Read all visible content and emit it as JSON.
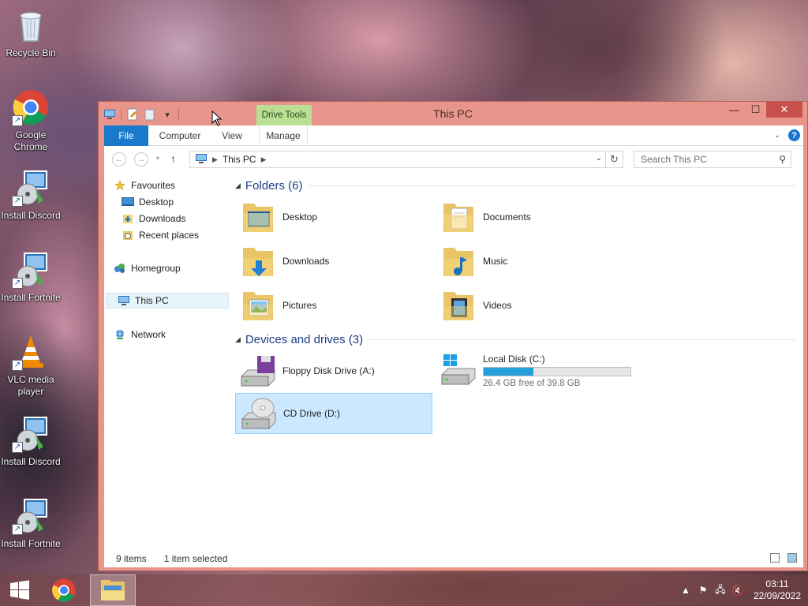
{
  "desktop": {
    "icons": [
      {
        "label": "Recycle Bin",
        "icon": "recycle-bin-icon"
      },
      {
        "label": "Google Chrome",
        "icon": "chrome-icon"
      },
      {
        "label": "Install Discord",
        "icon": "installer-icon"
      },
      {
        "label": "Install Fortnite",
        "icon": "installer-icon"
      },
      {
        "label": "VLC media player",
        "icon": "vlc-icon"
      },
      {
        "label": "Install Discord",
        "icon": "installer-icon"
      },
      {
        "label": "Install Fortnite",
        "icon": "installer-icon"
      }
    ]
  },
  "window": {
    "title": "This PC",
    "contextual_tab_group": "Drive Tools",
    "tabs": [
      "File",
      "Computer",
      "View",
      "Manage"
    ],
    "address": {
      "crumb": "This PC"
    },
    "search": {
      "placeholder": "Search This PC"
    },
    "nav_pane": {
      "favourites": "Favourites",
      "favourite_items": [
        "Desktop",
        "Downloads",
        "Recent places"
      ],
      "homegroup": "Homegroup",
      "this_pc": "This PC",
      "network": "Network"
    },
    "groups": {
      "folders_title": "Folders (6)",
      "folders": [
        "Desktop",
        "Documents",
        "Downloads",
        "Music",
        "Pictures",
        "Videos"
      ],
      "devices_title": "Devices and drives (3)",
      "floppy": "Floppy Disk Drive (A:)",
      "local_disk": {
        "name": "Local Disk (C:)",
        "free_text": "26.4 GB free of 39.8 GB",
        "used_fraction": 0.337
      },
      "cd_drive": "CD Drive (D:)"
    },
    "status": {
      "items": "9 items",
      "selected": "1 item selected"
    }
  },
  "taskbar": {
    "time": "03:11",
    "date": "22/09/2022"
  },
  "colors": {
    "window_frame": "#e8968c",
    "file_tab": "#1979ca",
    "drive_tools": "#b9df93",
    "selection": "#cce8ff",
    "disk_fill": "#26a0da",
    "group_title": "#1e3d87"
  }
}
